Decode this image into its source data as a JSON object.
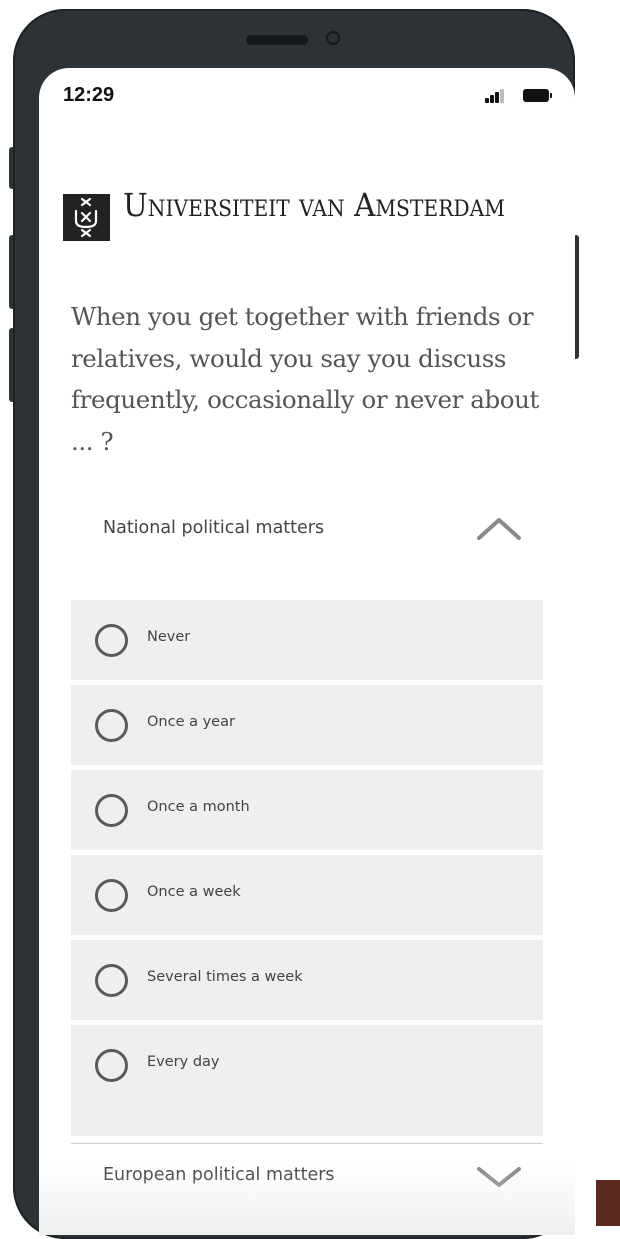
{
  "status_bar": {
    "time": "12:29"
  },
  "logo": {
    "text": "Universiteit van Amsterdam"
  },
  "survey": {
    "question": "When you get together with friends or relatives, would you say you discuss frequently, occasionally or never about ... ?",
    "sections": [
      {
        "label": "National political matters",
        "expanded": true,
        "options": [
          {
            "label": "Never",
            "selected": false
          },
          {
            "label": "Once a year",
            "selected": false
          },
          {
            "label": "Once a month",
            "selected": false
          },
          {
            "label": "Once a week",
            "selected": false
          },
          {
            "label": "Several times a week",
            "selected": false
          },
          {
            "label": "Every day",
            "selected": false
          }
        ]
      },
      {
        "label": "European political matters",
        "expanded": false
      }
    ]
  },
  "icons": {
    "expanded": "chevron-up-icon",
    "collapsed": "chevron-down-icon",
    "radio": "radio-unchecked-icon"
  },
  "colors": {
    "phone_frame": "#2d3236",
    "option_background": "#efefef",
    "question_text": "#555555",
    "radio_border": "#5a5a5a",
    "chevron": "#8a8a8a"
  }
}
